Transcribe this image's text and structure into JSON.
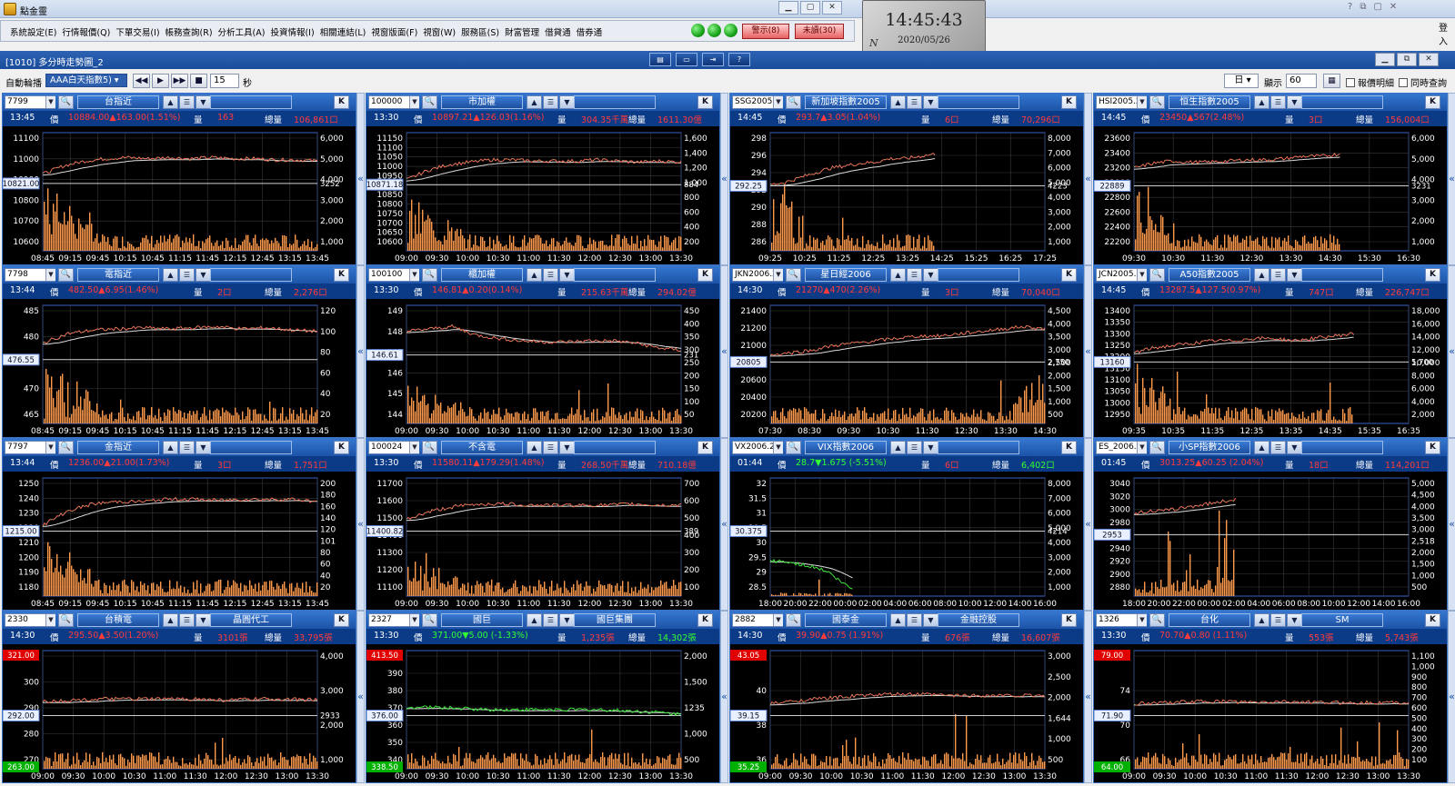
{
  "app": {
    "title": "點金靈",
    "login": "登入"
  },
  "menu": [
    "系統設定(E)",
    "行情報價(Q)",
    "下單交易(I)",
    "帳務查詢(R)",
    "分析工具(A)",
    "投資情報(I)",
    "相關連結(L)",
    "視窗版面(F)",
    "視窗(W)",
    "服務區(S)",
    "財富管理",
    "借貸通",
    "借券通"
  ],
  "buttons": {
    "alert": "警示(8)",
    "unread": "未讀(30)"
  },
  "clock": {
    "time": "14:45:43",
    "date": "2020/05/26",
    "badge": "N"
  },
  "window": {
    "title": "[1010] 多分時走勢圖_2"
  },
  "controls": {
    "auto_rotate_label": "自動輪播",
    "rotate_group": "AAA白天指數5)",
    "interval": "15",
    "interval_unit": "秒",
    "period": "日",
    "show_label": "顯示",
    "show_count": "60",
    "detail_label": "報價明細",
    "sync_label": "同時查詢"
  },
  "panels": [
    {
      "code": "7799",
      "name": "台指近",
      "name2": "",
      "time": "13:45",
      "price": "10884.00▲163.00(1.51%)",
      "vol": "163",
      "total": "106,861口",
      "vol_lbl": "量",
      "total_lbl": "總量",
      "price_lbl": "價",
      "pc": "red",
      "left_ticks": [
        "11100",
        "11000",
        "10900",
        "10800",
        "10700",
        "10600"
      ],
      "right_ticks": [
        "6,000",
        "5,000",
        "4,000",
        "3,000",
        "2,000",
        "1,000"
      ],
      "ref": "10821.00",
      "ref_r": "3252",
      "ref_pos": 0.57,
      "x_ticks": [
        "08:45",
        "09:15",
        "09:45",
        "10:15",
        "10:45",
        "11:15",
        "11:45",
        "12:15",
        "12:45",
        "13:15",
        "13:45"
      ],
      "trend": [
        0.65,
        0.72,
        0.76,
        0.78,
        0.79,
        0.78,
        0.79,
        0.78,
        0.79,
        0.78,
        0.78,
        0.77,
        0.77,
        0.76
      ],
      "fill": 1.0,
      "vspike": "early",
      "vmax": 0.6
    },
    {
      "code": "100000",
      "name": "市加權",
      "name2": "",
      "time": "13:30",
      "price": "10897.21▲126.03(1.16%)",
      "vol": "304.35千萬",
      "total": "1611.30億",
      "vol_lbl": "量",
      "total_lbl": "總量",
      "price_lbl": "價",
      "pc": "red",
      "left_ticks": [
        "11150",
        "11100",
        "11050",
        "11000",
        "10950",
        "10900",
        "10850",
        "10800",
        "10750",
        "10700",
        "10650",
        "10600"
      ],
      "right_ticks": [
        "1,600",
        "1,400",
        "1,200",
        "1,000",
        "800",
        "600",
        "400",
        "200"
      ],
      "ref": "10871.18",
      "ref_r": "884",
      "ref_pos": 0.56,
      "x_ticks": [
        "09:00",
        "09:30",
        "10:00",
        "10:30",
        "11:00",
        "11:30",
        "12:00",
        "12:30",
        "13:00",
        "13:30"
      ],
      "trend": [
        0.6,
        0.68,
        0.73,
        0.75,
        0.77,
        0.77,
        0.76,
        0.76,
        0.76,
        0.77,
        0.76,
        0.75,
        0.76,
        0.75
      ],
      "fill": 1.0,
      "vspike": "early",
      "vmax": 0.35
    },
    {
      "code": "SSG2005.2",
      "name": "新加坡指數2005",
      "name2": "",
      "time": "14:45",
      "price": "293.7▲3.05(1.04%)",
      "vol": "6口",
      "total": "70,296口",
      "vol_lbl": "量",
      "total_lbl": "總量",
      "price_lbl": "價",
      "pc": "red",
      "left_ticks": [
        "298",
        "296",
        "294",
        "292",
        "290",
        "288",
        "286"
      ],
      "right_ticks": [
        "8,000",
        "7,000",
        "6,000",
        "5,000",
        "4,000",
        "3,000",
        "2,000",
        "1,000"
      ],
      "ref": "292.25",
      "ref_r": "4223",
      "ref_pos": 0.55,
      "x_ticks": [
        "09:25",
        "10:25",
        "11:25",
        "12:25",
        "13:25",
        "14:25",
        "15:25",
        "16:25",
        "17:25"
      ],
      "trend": [
        0.56,
        0.58,
        0.62,
        0.66,
        0.7,
        0.72,
        0.74,
        0.75,
        0.78,
        0.78,
        0.8,
        0.82
      ],
      "fill": 0.6,
      "vspike": "early",
      "vmax": 0.8
    },
    {
      "code": "HSI2005.2",
      "name": "恒生指數2005",
      "name2": "",
      "time": "14:45",
      "price": "23450▲567(2.48%)",
      "vol": "3口",
      "total": "156,004口",
      "vol_lbl": "量",
      "total_lbl": "總量",
      "price_lbl": "價",
      "pc": "red",
      "left_ticks": [
        "23600",
        "23400",
        "23200",
        "23000",
        "22800",
        "22600",
        "22400",
        "22200"
      ],
      "right_ticks": [
        "6,000",
        "5,000",
        "4,000",
        "3,000",
        "2,000",
        "1,000"
      ],
      "ref": "22889",
      "ref_r": "3231",
      "ref_pos": 0.55,
      "x_ticks": [
        "09:30",
        "10:30",
        "11:30",
        "12:30",
        "13:30",
        "14:30",
        "15:30",
        "16:30"
      ],
      "trend": [
        0.7,
        0.74,
        0.76,
        0.75,
        0.75,
        0.76,
        0.77,
        0.77,
        0.78,
        0.8,
        0.8,
        0.82
      ],
      "fill": 0.75,
      "vspike": "early",
      "vmax": 0.5
    },
    {
      "code": "7798",
      "name": "電指近",
      "name2": "",
      "time": "13:44",
      "price": "482.50▲6.95(1.46%)",
      "vol": "2口",
      "total": "2,276口",
      "vol_lbl": "量",
      "total_lbl": "總量",
      "price_lbl": "價",
      "pc": "red",
      "left_ticks": [
        "485",
        "480",
        "475",
        "470",
        "465"
      ],
      "right_ticks": [
        "120",
        "100",
        "80",
        "60",
        "40",
        "20"
      ],
      "ref": "476.55",
      "ref_r": "",
      "ref_pos": 0.54,
      "x_ticks": [
        "08:45",
        "09:15",
        "09:45",
        "10:15",
        "10:45",
        "11:15",
        "11:45",
        "12:15",
        "12:45",
        "13:15",
        "13:45"
      ],
      "trend": [
        0.68,
        0.76,
        0.79,
        0.8,
        0.81,
        0.8,
        0.81,
        0.82,
        0.8,
        0.81,
        0.79,
        0.78
      ],
      "fill": 1.0,
      "vspike": "early",
      "vmax": 0.55
    },
    {
      "code": "100100",
      "name": "櫃加權",
      "name2": "",
      "time": "13:30",
      "price": "146.81▲0.20(0.14%)",
      "vol": "215.63千萬",
      "total": "294.02億",
      "vol_lbl": "量",
      "total_lbl": "總量",
      "price_lbl": "價",
      "pc": "red",
      "left_ticks": [
        "149",
        "148",
        "147",
        "146",
        "145",
        "144"
      ],
      "right_ticks": [
        "450",
        "400",
        "350",
        "300",
        "250",
        "200",
        "150",
        "100",
        "50"
      ],
      "ref": "146.61",
      "ref_r": "231",
      "ref_pos": 0.58,
      "x_ticks": [
        "09:00",
        "09:30",
        "10:00",
        "10:30",
        "11:00",
        "11:30",
        "12:00",
        "12:30",
        "13:00",
        "13:30"
      ],
      "trend": [
        0.78,
        0.8,
        0.82,
        0.75,
        0.72,
        0.7,
        0.69,
        0.69,
        0.7,
        0.7,
        0.68,
        0.64,
        0.62
      ],
      "fill": 1.0,
      "vspike": "early",
      "vmax": 0.25
    },
    {
      "code": "JKN2006.2",
      "name": "星日經2006",
      "name2": "",
      "time": "14:30",
      "price": "21270▲470(2.26%)",
      "vol": "3口",
      "total": "70,040口",
      "vol_lbl": "量",
      "total_lbl": "總量",
      "price_lbl": "價",
      "pc": "red",
      "left_ticks": [
        "21400",
        "21200",
        "21000",
        "20800",
        "20600",
        "20400",
        "20200"
      ],
      "right_ticks": [
        "4,500",
        "4,000",
        "3,500",
        "3,000",
        "2,500",
        "2,000",
        "1,500",
        "1,000",
        "500"
      ],
      "ref": "20805",
      "ref_r": "2,750",
      "ref_pos": 0.52,
      "x_ticks": [
        "07:30",
        "08:30",
        "09:30",
        "10:30",
        "11:30",
        "12:30",
        "13:30",
        "14:30"
      ],
      "trend": [
        0.58,
        0.6,
        0.62,
        0.66,
        0.68,
        0.7,
        0.72,
        0.74,
        0.74,
        0.76,
        0.78,
        0.8,
        0.82,
        0.8
      ],
      "fill": 1.0,
      "vspike": "late",
      "vmax": 0.45
    },
    {
      "code": "JCN2005.2",
      "name": "A50指數2005",
      "name2": "",
      "time": "14:45",
      "price": "13287.5▲127.5(0.97%)",
      "vol": "747口",
      "total": "226,747口",
      "vol_lbl": "量",
      "total_lbl": "總量",
      "price_lbl": "價",
      "pc": "red",
      "left_ticks": [
        "13400",
        "13350",
        "13300",
        "13250",
        "13200",
        "13150",
        "13100",
        "13050",
        "13000",
        "12950"
      ],
      "right_ticks": [
        "18,000",
        "16,000",
        "14,000",
        "12,000",
        "10,000",
        "8,000",
        "6,000",
        "4,000",
        "2,000"
      ],
      "ref": "13160",
      "ref_r": "5,700",
      "ref_pos": 0.52,
      "x_ticks": [
        "09:35",
        "10:35",
        "11:35",
        "12:35",
        "13:35",
        "14:35",
        "15:35",
        "16:35"
      ],
      "trend": [
        0.6,
        0.64,
        0.66,
        0.68,
        0.7,
        0.7,
        0.72,
        0.72,
        0.7,
        0.72,
        0.74,
        0.76
      ],
      "fill": 0.8,
      "vspike": "early",
      "vmax": 0.4
    },
    {
      "code": "7797",
      "name": "金指近",
      "name2": "",
      "time": "13:44",
      "price": "1236.00▲21.00(1.73%)",
      "vol": "3口",
      "total": "1,751口",
      "vol_lbl": "量",
      "total_lbl": "總量",
      "price_lbl": "價",
      "pc": "red",
      "left_ticks": [
        "1250",
        "1240",
        "1230",
        "1220",
        "1210",
        "1200",
        "1190",
        "1180"
      ],
      "right_ticks": [
        "200",
        "180",
        "160",
        "140",
        "120",
        "101",
        "80",
        "60",
        "40",
        "20"
      ],
      "ref": "1215.00",
      "ref_r": "",
      "ref_pos": 0.55,
      "x_ticks": [
        "08:45",
        "09:15",
        "09:45",
        "10:15",
        "10:45",
        "11:15",
        "11:45",
        "12:15",
        "12:45",
        "13:15",
        "13:45"
      ],
      "trend": [
        0.6,
        0.72,
        0.78,
        0.8,
        0.8,
        0.82,
        0.82,
        0.81,
        0.82,
        0.82,
        0.82,
        0.8
      ],
      "fill": 1.0,
      "vspike": "early",
      "vmax": 0.4
    },
    {
      "code": "100024",
      "name": "不含電",
      "name2": "",
      "time": "13:30",
      "price": "11580.11▲179.29(1.48%)",
      "vol": "268.50千萬",
      "total": "710.18億",
      "vol_lbl": "量",
      "total_lbl": "總量",
      "price_lbl": "價",
      "pc": "red",
      "left_ticks": [
        "11700",
        "11600",
        "11500",
        "11400",
        "11300",
        "11200",
        "11100"
      ],
      "right_ticks": [
        "700",
        "600",
        "500",
        "400",
        "300",
        "200",
        "100"
      ],
      "ref": "11400.82",
      "ref_r": "389",
      "ref_pos": 0.55,
      "x_ticks": [
        "09:00",
        "09:30",
        "10:00",
        "10:30",
        "11:00",
        "11:30",
        "12:00",
        "12:30",
        "13:00",
        "13:30"
      ],
      "trend": [
        0.65,
        0.72,
        0.76,
        0.78,
        0.78,
        0.77,
        0.77,
        0.77,
        0.77,
        0.78,
        0.77,
        0.77
      ],
      "fill": 1.0,
      "vspike": "early",
      "vmax": 0.2
    },
    {
      "code": "VX2006.2",
      "name": "VIX指數2006",
      "name2": "",
      "time": "01:44",
      "price": "28.7▼1.675 (-5.51%)",
      "vol": "6口",
      "total": "6,402口",
      "vol_lbl": "量",
      "total_lbl": "總量",
      "price_lbl": "價",
      "pc": "green",
      "left_ticks": [
        "32",
        "31.5",
        "31",
        "30.5",
        "30",
        "29.5",
        "29",
        "28.5"
      ],
      "right_ticks": [
        "8,000",
        "7,000",
        "6,000",
        "5,000",
        "4,000",
        "3,000",
        "2,000",
        "1,000"
      ],
      "ref": "30.375",
      "ref_r": "4214",
      "ref_pos": 0.55,
      "x_ticks": [
        "18:00",
        "20:00",
        "22:00",
        "00:00",
        "02:00",
        "04:00",
        "06:00",
        "08:00",
        "10:00",
        "12:00",
        "14:00",
        "16:00"
      ],
      "trend": [
        0.3,
        0.29,
        0.28,
        0.26,
        0.24,
        0.2,
        0.12,
        0.06
      ],
      "fill": 0.3,
      "vspike": "none",
      "vmax": 0.05
    },
    {
      "code": "ES_2006.2",
      "name": "小SP指數2006",
      "name2": "",
      "time": "01:45",
      "price": "3013.25▲60.25 (2.04%)",
      "vol": "18口",
      "total": "114,201口",
      "vol_lbl": "量",
      "total_lbl": "總量",
      "price_lbl": "價",
      "pc": "red",
      "left_ticks": [
        "3040",
        "3020",
        "3000",
        "2980",
        "2960",
        "2940",
        "2920",
        "2900",
        "2880"
      ],
      "right_ticks": [
        "5,000",
        "4,500",
        "4,000",
        "3,500",
        "3,000",
        "2,518",
        "2,000",
        "1,500",
        "1,000",
        "500"
      ],
      "ref": "2953",
      "ref_r": "",
      "ref_pos": 0.52,
      "x_ticks": [
        "18:00",
        "20:00",
        "22:00",
        "00:00",
        "02:00",
        "04:00",
        "06:00",
        "08:00",
        "10:00",
        "12:00",
        "14:00",
        "16:00"
      ],
      "trend": [
        0.7,
        0.72,
        0.72,
        0.74,
        0.76,
        0.78,
        0.8,
        0.82
      ],
      "fill": 0.37,
      "vspike": "mixed",
      "vmax": 0.7
    },
    {
      "code": "2330",
      "name": "台積電",
      "name2": "晶圓代工",
      "time": "14:30",
      "price": "295.50▲3.50(1.20%)",
      "vol": "3101張",
      "total": "33,795張",
      "vol_lbl": "量",
      "total_lbl": "總量",
      "price_lbl": "價",
      "pc": "red",
      "left_ticks": [
        "310",
        "300",
        "290",
        "280",
        "270"
      ],
      "right_ticks": [
        "4,000",
        "3,000",
        "2,000",
        "1,000"
      ],
      "ref": "292.00",
      "ref_r": "2933",
      "ref_pos": 0.45,
      "hi": "321.00",
      "lo": "263.00",
      "x_ticks": [
        "09:00",
        "09:30",
        "10:00",
        "10:30",
        "11:00",
        "11:30",
        "12:00",
        "12:30",
        "13:00",
        "13:30"
      ],
      "trend": [
        0.57,
        0.58,
        0.59,
        0.59,
        0.59,
        0.59,
        0.58,
        0.59,
        0.59,
        0.58
      ],
      "fill": 1.0,
      "vspike": "low",
      "vmax": 0.1
    },
    {
      "code": "2327",
      "name": "國巨",
      "name2": "國巨集團",
      "time": "13:30",
      "price": "371.00▼5.00 (-1.33%)",
      "vol": "1,235張",
      "total": "14,302張",
      "vol_lbl": "量",
      "total_lbl": "總量",
      "price_lbl": "價",
      "pc": "green",
      "left_ticks": [
        "400",
        "390",
        "380",
        "370",
        "360",
        "350",
        "340"
      ],
      "right_ticks": [
        "2,000",
        "1,500",
        "1235",
        "1,000",
        "500"
      ],
      "ref": "376.00",
      "ref_r": "",
      "ref_pos": 0.45,
      "hi": "413.50",
      "lo": "338.50",
      "x_ticks": [
        "09:00",
        "09:30",
        "10:00",
        "10:30",
        "11:00",
        "11:30",
        "12:00",
        "12:30",
        "13:00",
        "13:30"
      ],
      "trend": [
        0.52,
        0.52,
        0.51,
        0.5,
        0.5,
        0.5,
        0.5,
        0.5,
        0.49,
        0.48,
        0.46
      ],
      "fill": 1.0,
      "vspike": "low",
      "vmax": 0.1
    },
    {
      "code": "2882",
      "name": "國泰金",
      "name2": "金融控股",
      "time": "14:30",
      "price": "39.90▲0.75 (1.91%)",
      "vol": "676張",
      "total": "16,607張",
      "vol_lbl": "量",
      "total_lbl": "總量",
      "price_lbl": "價",
      "pc": "red",
      "left_ticks": [
        "42",
        "40",
        "38",
        "36"
      ],
      "right_ticks": [
        "3,000",
        "2,500",
        "2,000",
        "1,644",
        "1,000",
        "500"
      ],
      "ref": "39.15",
      "ref_r": "",
      "ref_pos": 0.45,
      "hi": "43.05",
      "lo": "35.25",
      "x_ticks": [
        "09:00",
        "09:30",
        "10:00",
        "10:30",
        "11:00",
        "11:30",
        "12:00",
        "12:30",
        "13:00",
        "13:30"
      ],
      "trend": [
        0.55,
        0.58,
        0.6,
        0.62,
        0.63,
        0.63,
        0.62,
        0.62,
        0.62,
        0.62
      ],
      "fill": 1.0,
      "vspike": "low",
      "vmax": 0.35
    },
    {
      "code": "1326",
      "name": "台化",
      "name2": "SM",
      "time": "13:30",
      "price": "70.70▲0.80 (1.11%)",
      "vol": "553張",
      "total": "5,743張",
      "vol_lbl": "量",
      "total_lbl": "總量",
      "price_lbl": "價",
      "pc": "red",
      "left_ticks": [
        "78",
        "74",
        "70",
        "66"
      ],
      "right_ticks": [
        "1,100",
        "1,000",
        "900",
        "800",
        "700",
        "600",
        "500",
        "400",
        "300",
        "200",
        "100"
      ],
      "ref": "71.90",
      "ref_r": "",
      "ref_pos": 0.45,
      "hi": "79.00",
      "lo": "64.00",
      "x_ticks": [
        "09:00",
        "09:30",
        "10:00",
        "10:30",
        "11:00",
        "11:30",
        "12:00",
        "12:30",
        "13:00",
        "13:30"
      ],
      "trend": [
        0.55,
        0.56,
        0.57,
        0.57,
        0.56,
        0.57,
        0.56,
        0.56,
        0.56,
        0.56
      ],
      "fill": 1.0,
      "vspike": "low",
      "vmax": 0.2
    }
  ]
}
